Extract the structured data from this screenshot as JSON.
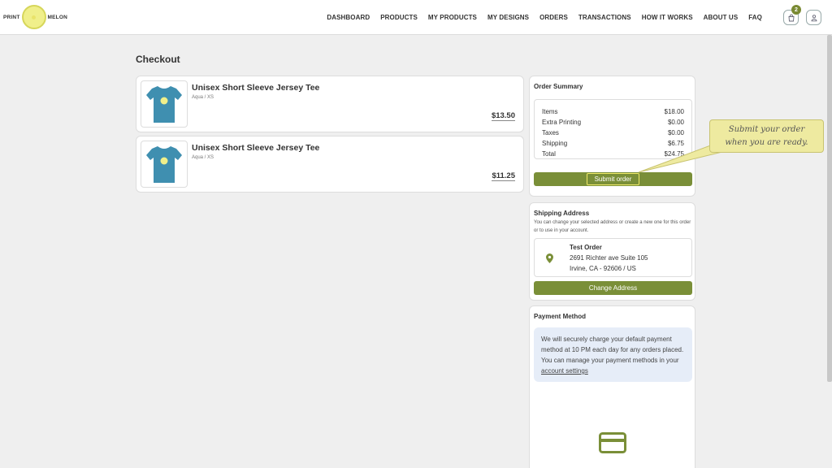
{
  "header": {
    "logo_left": "PRINT",
    "logo_right": "MELON",
    "nav": [
      "DASHBOARD",
      "PRODUCTS",
      "MY PRODUCTS",
      "MY DESIGNS",
      "ORDERS",
      "TRANSACTIONS",
      "HOW IT WORKS",
      "ABOUT US",
      "FAQ"
    ],
    "cart_count": "2"
  },
  "page_title": "Checkout",
  "products": [
    {
      "name": "Unisex Short Sleeve Jersey Tee",
      "variant": "Aqua / XS",
      "price": "$13.50"
    },
    {
      "name": "Unisex Short Sleeve Jersey Tee",
      "variant": "Aqua / XS",
      "price": "$11.25"
    }
  ],
  "summary": {
    "title": "Order Summary",
    "rows": [
      {
        "label": "Items",
        "value": "$18.00"
      },
      {
        "label": "Extra Printing",
        "value": "$0.00"
      },
      {
        "label": "Taxes",
        "value": "$0.00"
      },
      {
        "label": "Shipping",
        "value": "$6.75"
      },
      {
        "label": "Total",
        "value": "$24.75"
      }
    ],
    "submit_label": "Submit order"
  },
  "shipping": {
    "title": "Shipping Address",
    "subtitle": "You can change your selected address or create a new one for this order or to use in your account.",
    "name": "Test Order",
    "line1": "2691 Richter ave Suite 105",
    "line2": "Irvine, CA - 92606 / US",
    "change_label": "Change Address"
  },
  "payment": {
    "title": "Payment Method",
    "info": "We will securely charge your default payment method at 10 PM each day for any orders placed. You can manage your payment methods in your",
    "link": "account settings"
  },
  "callout": {
    "line1": "Submit your order",
    "line2": "when you are ready."
  },
  "colors": {
    "accent": "#7a8f38",
    "tee": "#3f8fb0",
    "callout_bg": "#eeeaa0",
    "info_bg": "#e6edf8"
  }
}
